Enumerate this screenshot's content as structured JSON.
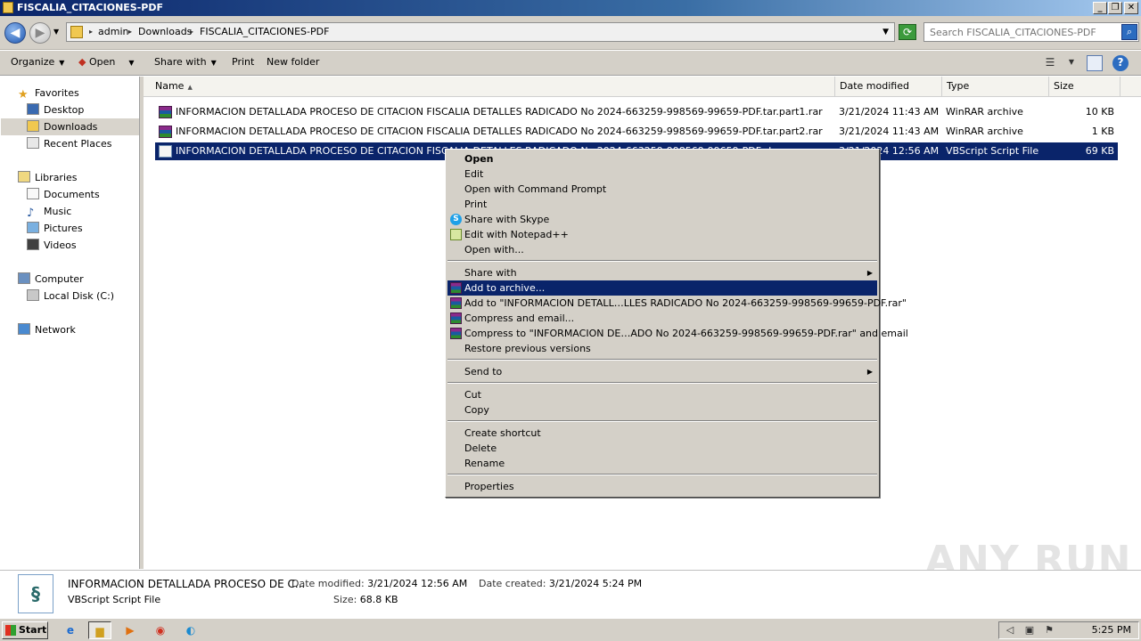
{
  "window": {
    "title": "FISCALIA_CITACIONES-PDF"
  },
  "address": {
    "crumbs": [
      "admin",
      "Downloads",
      "FISCALIA_CITACIONES-PDF"
    ]
  },
  "search": {
    "placeholder": "Search FISCALIA_CITACIONES-PDF"
  },
  "toolbar": {
    "organize": "Organize",
    "open": "Open",
    "share_with": "Share with",
    "print": "Print",
    "new_folder": "New folder"
  },
  "sidebar": {
    "favorites": "Favorites",
    "desktop": "Desktop",
    "downloads": "Downloads",
    "recent": "Recent Places",
    "libraries": "Libraries",
    "documents": "Documents",
    "music": "Music",
    "pictures": "Pictures",
    "videos": "Videos",
    "computer": "Computer",
    "local_disk": "Local Disk (C:)",
    "network": "Network"
  },
  "columns": {
    "name": "Name",
    "date": "Date modified",
    "type": "Type",
    "size": "Size"
  },
  "files": [
    {
      "name": "INFORMACION DETALLADA PROCESO DE CITACION FISCALIA DETALLES RADICADO No 2024-663259-998569-99659-PDF.tar.part1.rar",
      "date": "3/21/2024 11:43 AM",
      "type": "WinRAR archive",
      "size": "10 KB"
    },
    {
      "name": "INFORMACION DETALLADA PROCESO DE CITACION FISCALIA DETALLES RADICADO No 2024-663259-998569-99659-PDF.tar.part2.rar",
      "date": "3/21/2024 11:43 AM",
      "type": "WinRAR archive",
      "size": "1 KB"
    },
    {
      "name": "INFORMACION DETALLADA PROCESO DE CITACION FISCALIA DETALLES RADICADO No 2024-663259-998569-99659-PDF.vbs",
      "date": "3/21/2024 12:56 AM",
      "type": "VBScript Script File",
      "size": "69 KB"
    }
  ],
  "context_menu": {
    "open": "Open",
    "edit": "Edit",
    "open_cmd": "Open with Command Prompt",
    "print": "Print",
    "skype": "Share with Skype",
    "npp": "Edit with Notepad++",
    "open_with": "Open with...",
    "share_with": "Share with",
    "add_archive": "Add to archive...",
    "add_to_rar": "Add to \"INFORMACION DETALL…LLES RADICADO No 2024-663259-998569-99659-PDF.rar\"",
    "compress_email": "Compress and email...",
    "compress_to_rar_email": "Compress to \"INFORMACION DE…ADO No 2024-663259-998569-99659-PDF.rar\" and email",
    "restore": "Restore previous versions",
    "send_to": "Send to",
    "cut": "Cut",
    "copy": "Copy",
    "create_shortcut": "Create shortcut",
    "delete": "Delete",
    "rename": "Rename",
    "properties": "Properties"
  },
  "details": {
    "name": "INFORMACION DETALLADA PROCESO DE C...",
    "type": "VBScript Script File",
    "modified_label": "Date modified:",
    "modified": "3/21/2024 12:56 AM",
    "created_label": "Date created:",
    "created": "3/21/2024 5:24 PM",
    "size_label": "Size:",
    "size": "68.8 KB"
  },
  "watermark": "ANY RUN",
  "taskbar": {
    "start": "Start",
    "clock": "5:25 PM"
  }
}
